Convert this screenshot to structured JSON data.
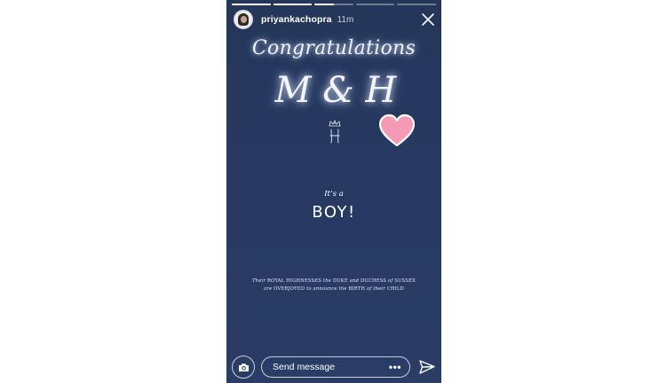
{
  "story": {
    "progress": [
      1,
      1,
      0.5,
      0,
      0
    ],
    "username": "priyankachopra",
    "time": "11m",
    "background_color": "#283a63",
    "accent_heart_color": "#f49ab6"
  },
  "content": {
    "congrats": "Congratulations",
    "monogram": "M & H",
    "its_a": "It’s a",
    "boy": "BOY!",
    "announcement": {
      "w1": "Their",
      "w2": "ROYAL HIGHNESSES",
      "w3": "the",
      "w4": "DUKE",
      "w5": "and",
      "w6": "DUCHESS",
      "w7": "of",
      "w8": "SUSSEX",
      "w9": "are",
      "w10": "OVERJOYED",
      "w11": "to announce the",
      "w12": "BIRTH",
      "w13": "of their",
      "w14": "CHILD"
    }
  },
  "footer": {
    "send_message_placeholder": "Send message",
    "more_label": "•••"
  }
}
